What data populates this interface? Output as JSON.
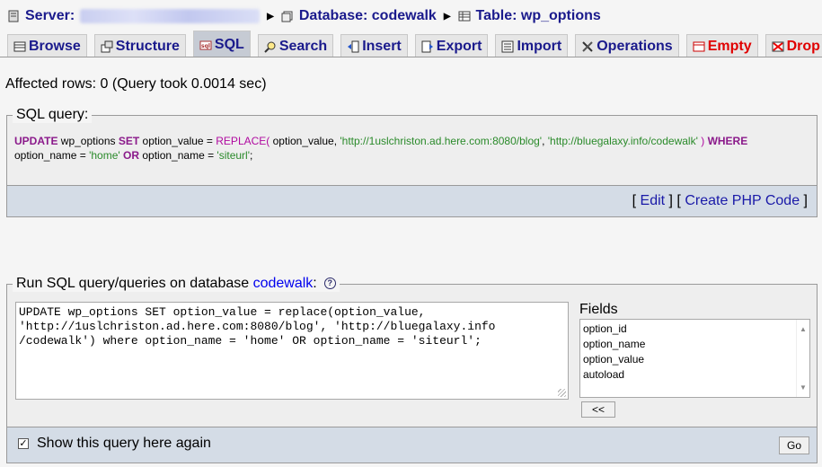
{
  "breadcrumb": {
    "server_label": "Server:",
    "database_label": "Database: codewalk",
    "table_label": "Table: wp_options"
  },
  "tabs": [
    {
      "label": "Browse",
      "icon": "browse-icon"
    },
    {
      "label": "Structure",
      "icon": "structure-icon"
    },
    {
      "label": "SQL",
      "icon": "sql-icon",
      "active": true
    },
    {
      "label": "Search",
      "icon": "search-icon"
    },
    {
      "label": "Insert",
      "icon": "insert-icon"
    },
    {
      "label": "Export",
      "icon": "export-icon"
    },
    {
      "label": "Import",
      "icon": "import-icon"
    },
    {
      "label": "Operations",
      "icon": "operations-icon"
    },
    {
      "label": "Empty",
      "icon": "empty-icon",
      "color": "#e00000"
    },
    {
      "label": "Drop",
      "icon": "drop-icon",
      "color": "#e00000"
    }
  ],
  "result": {
    "affected": "Affected rows: 0 (Query took 0.0014 sec)"
  },
  "sql_query": {
    "legend": "SQL query:",
    "t1": "UPDATE",
    "t2": " wp_options ",
    "t3": "SET",
    "t4": " option_value = ",
    "t5": "REPLACE(",
    "t6": " option_value, ",
    "t7": "'http://1uslchriston.ad.here.com:8080/blog'",
    "t8": ", ",
    "t9": "'http://bluegalaxy.info/codewalk'",
    "t10": " ) ",
    "t11": "WHERE",
    "t12": "option_name = ",
    "t13": "'home'",
    "t14": " ",
    "t15": "OR",
    "t16": " option_name = ",
    "t17": "'siteurl'",
    "t18": ";",
    "edit": "Edit",
    "create_php": "Create PHP Code"
  },
  "run_sql": {
    "legend_text": "Run SQL query/queries on database ",
    "db_link": "codewalk",
    "legend_colon": ":",
    "textarea": "UPDATE wp_options SET option_value = replace(option_value,\n'http://1uslchriston.ad.here.com:8080/blog', 'http://bluegalaxy.info\n/codewalk') where option_name = 'home' OR option_name = 'siteurl';",
    "fields_label": "Fields",
    "fields": [
      "option_id",
      "option_name",
      "option_value",
      "autoload"
    ],
    "insert_button": "<<",
    "show_again_label": "Show this query here again",
    "show_again_checked": true,
    "go_button": "Go"
  }
}
